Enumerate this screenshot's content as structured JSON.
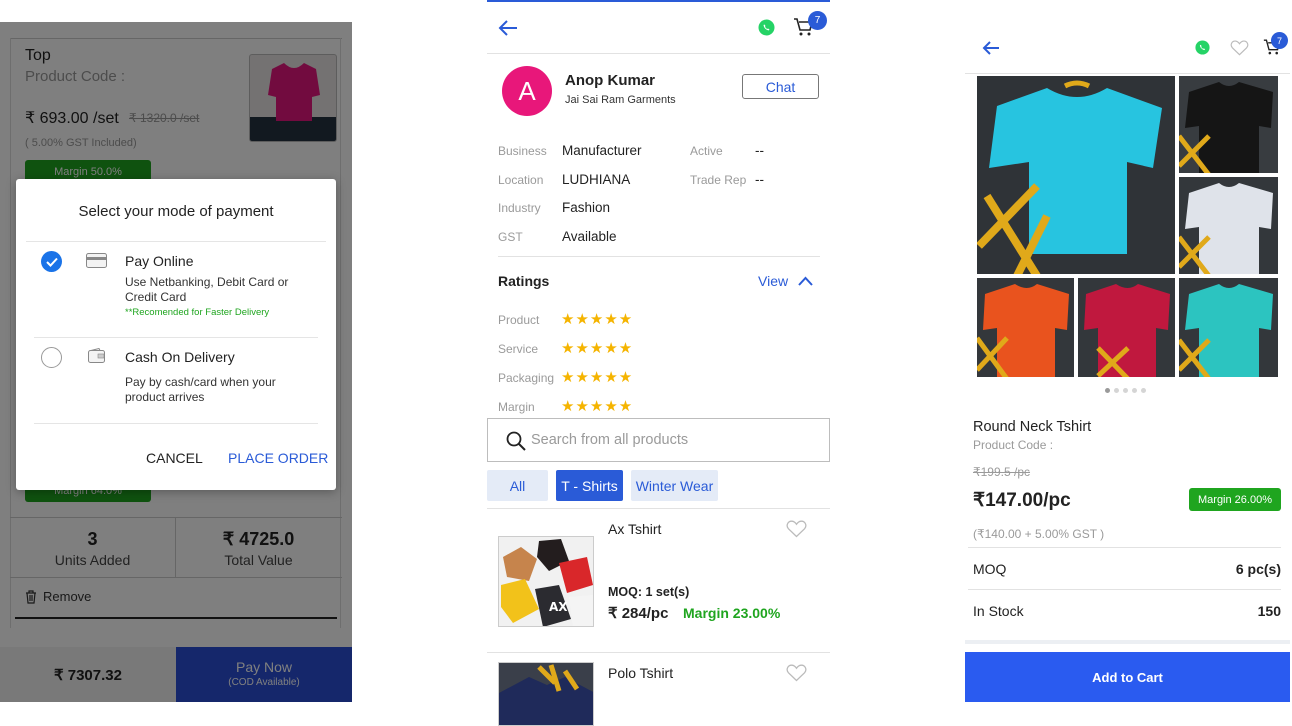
{
  "screen1": {
    "product_name": "Top",
    "product_code_label": "Product Code :",
    "price": "₹ 693.00 /set",
    "old_price": "₹ 1320.0 /set",
    "gst_note": "( 5.00% GST Included)",
    "margin_top": "Margin 50.0%",
    "margin_bottom": "Margin 64.0%",
    "units_value": "3",
    "units_label": "Units Added",
    "total_value": "₹ 4725.0",
    "total_label": "Total Value",
    "remove_label": "Remove",
    "grand_total": "₹ 7307.32",
    "pay_now_label": "Pay Now",
    "pay_now_sub": "(COD Available)",
    "modal": {
      "title": "Select your mode of payment",
      "option1_title": "Pay Online",
      "option1_desc": "Use Netbanking, Debit Card or Credit Card",
      "option1_note": "**Recomended for Faster Delivery",
      "option2_title": "Cash On Delivery",
      "option2_desc": "Pay by cash/card when your product arrives",
      "cancel_label": "CANCEL",
      "place_order_label": "PLACE ORDER"
    }
  },
  "screen2": {
    "cart_count": "7",
    "avatar_letter": "A",
    "seller_name": "Anop Kumar",
    "seller_company": "Jai Sai Ram Garments",
    "chat_label": "Chat",
    "info": [
      {
        "label": "Business",
        "value": "Manufacturer"
      },
      {
        "label": "Location",
        "value": "LUDHIANA"
      },
      {
        "label": "Industry",
        "value": "Fashion"
      },
      {
        "label": "GST",
        "value": "Available"
      }
    ],
    "info_right": [
      {
        "label": "Active",
        "value": "--"
      },
      {
        "label": "Trade Rep",
        "value": "--"
      }
    ],
    "ratings_title": "Ratings",
    "view_label": "View",
    "ratings": [
      {
        "label": "Product",
        "stars": "★★★★★",
        "value": 5
      },
      {
        "label": "Service",
        "stars": "★★★★★",
        "value": 5
      },
      {
        "label": "Packaging",
        "stars": "★★★★★",
        "value": 5
      },
      {
        "label": "Margin",
        "stars": "★★★★★",
        "value": 5
      }
    ],
    "search_placeholder": "Search from all products",
    "filters": [
      "All",
      "T - Shirts",
      "Winter Wear"
    ],
    "selected_filter": "T - Shirts",
    "products": [
      {
        "name": "Ax Tshirt",
        "moq": "MOQ: 1 set(s)",
        "price": "₹ 284/pc",
        "margin": "Margin 23.00%"
      },
      {
        "name": "Polo Tshirt"
      }
    ],
    "colors": {
      "accent": "#2a5bd7",
      "avatar": "#e8177a",
      "whatsapp": "#25d366",
      "margin_green": "#1fa51f"
    }
  },
  "screen3": {
    "cart_count": "7",
    "product_name": "Round Neck Tshirt",
    "product_code_label": "Product Code :",
    "old_price": "₹199.5 /pc",
    "price": "₹147.00/pc",
    "margin_badge": "Margin 26.00%",
    "gst_note": "(₹140.00 + 5.00% GST )",
    "moq_label": "MOQ",
    "moq_value": "6 pc(s)",
    "stock_label": "In Stock",
    "stock_value": "150",
    "add_to_cart_label": "Add to Cart",
    "carousel_pages": 5,
    "carousel_active": 1
  }
}
